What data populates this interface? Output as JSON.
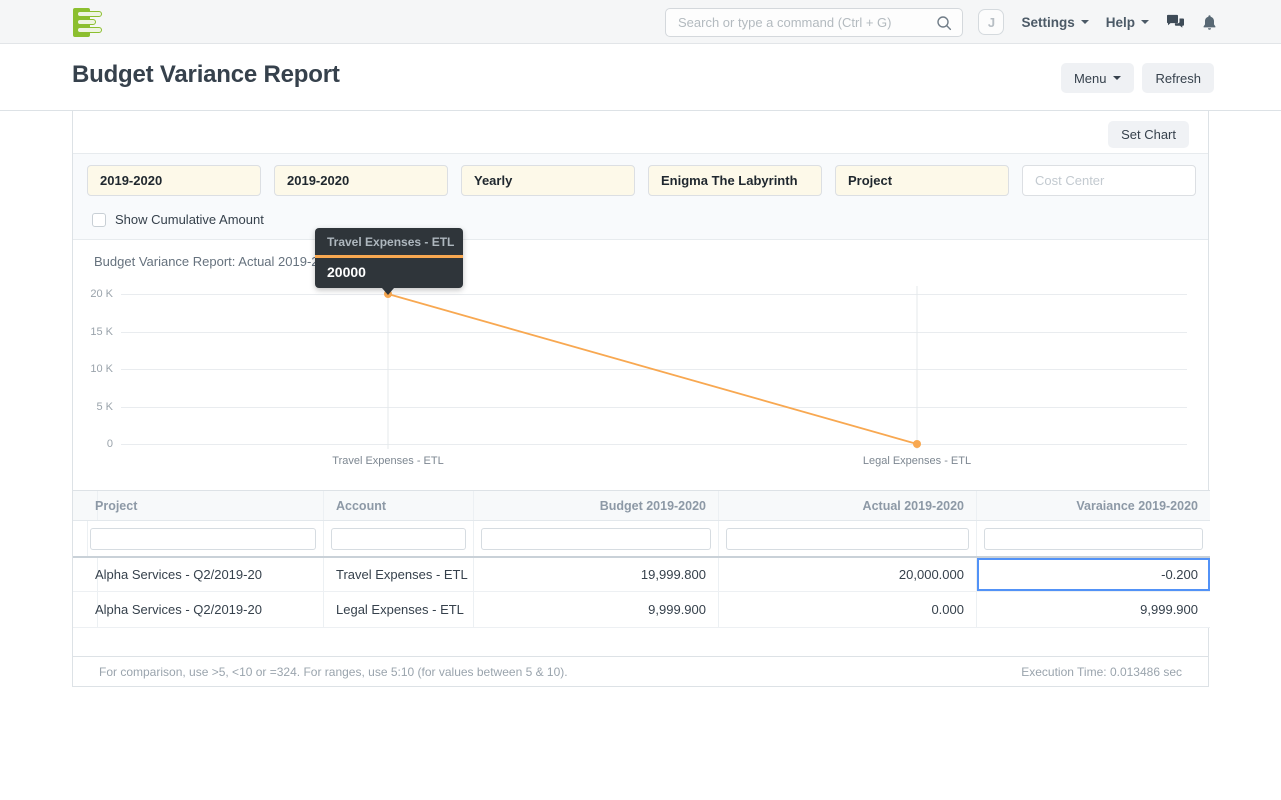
{
  "navbar": {
    "search_placeholder": "Search or type a command (Ctrl + G)",
    "avatar_initial": "J",
    "settings_label": "Settings",
    "help_label": "Help"
  },
  "header": {
    "title": "Budget Variance Report",
    "menu_label": "Menu",
    "refresh_label": "Refresh",
    "set_chart_label": "Set Chart"
  },
  "filters": [
    {
      "value": "2019-2020"
    },
    {
      "value": "2019-2020"
    },
    {
      "value": "Yearly"
    },
    {
      "value": "Enigma The Labyrinth"
    },
    {
      "value": "Project"
    },
    {
      "value": "",
      "placeholder": "Cost Center"
    }
  ],
  "cumulative": {
    "label": "Show Cumulative Amount",
    "checked": false
  },
  "tooltip": {
    "title": "Travel Expenses - ETL",
    "value": "20000"
  },
  "chart_data": {
    "type": "line",
    "title": "Budget Variance Report: Actual 2019-2020 vs Account",
    "categories": [
      "Travel Expenses - ETL",
      "Legal Expenses - ETL"
    ],
    "series": [
      {
        "name": "Actual 2019-2020",
        "values": [
          20000,
          0
        ]
      }
    ],
    "ylim": [
      0,
      20000
    ],
    "yticks": [
      "20 K",
      "15 K",
      "10 K",
      "5 K",
      "0"
    ],
    "line_color": "#f8a851",
    "grid": true,
    "legend_position": "none"
  },
  "table": {
    "columns": [
      "Project",
      "Account",
      "Budget 2019-2020",
      "Actual 2019-2020",
      "Varaiance 2019-2020"
    ],
    "rows": [
      [
        "Alpha Services - Q2/2019-20",
        "Travel Expenses - ETL",
        "19,999.800",
        "20,000.000",
        "-0.200"
      ],
      [
        "Alpha Services - Q2/2019-20",
        "Legal Expenses - ETL",
        "9,999.900",
        "0.000",
        "9,999.900"
      ]
    ]
  },
  "footer": {
    "hint": "For comparison, use >5, <10 or =324. For ranges, use 5:10 (for values between 5 & 10).",
    "execution_time": "Execution Time: 0.013486 sec"
  }
}
